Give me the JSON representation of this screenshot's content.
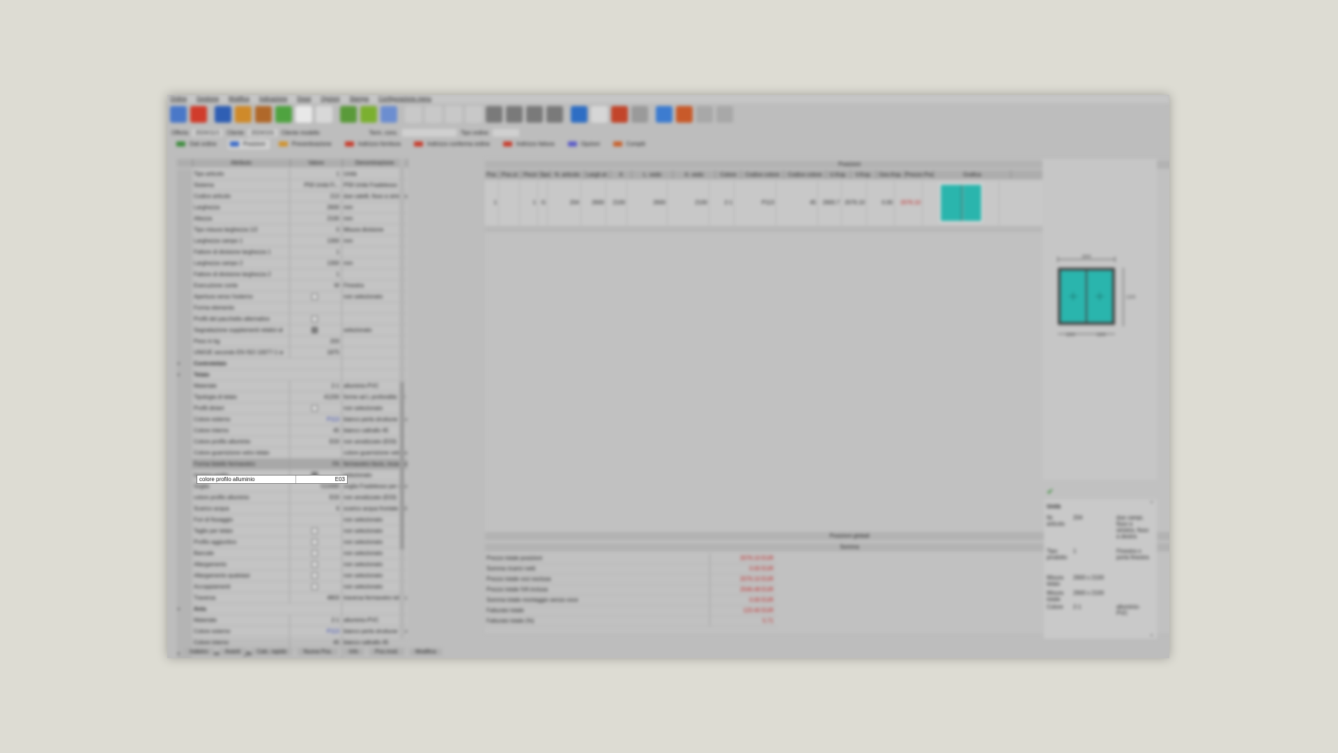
{
  "menu": [
    "Ordine",
    "Gestione",
    "Modifica",
    "Indicazione",
    "Dossi",
    "Opzioni",
    "Stampa",
    "Configurazione menu"
  ],
  "toolbar": {
    "icons": [
      {
        "name": "settings-icon",
        "color": "#4a78c8"
      },
      {
        "name": "stop-icon",
        "color": "#d03c2c"
      },
      {
        "name": "save-icon",
        "color": "#2f5fb4"
      },
      {
        "name": "users-icon",
        "color": "#cf8a2a"
      },
      {
        "name": "group-icon",
        "color": "#b0682a"
      },
      {
        "name": "recycle-icon",
        "color": "#4fa340"
      },
      {
        "name": "document-icon",
        "color": "#e8e8e8"
      },
      {
        "name": "list-icon",
        "color": "#d8d8d8"
      },
      {
        "name": "tree-icon",
        "color": "#5a9a3a"
      },
      {
        "name": "edit-icon",
        "color": "#7bb030"
      },
      {
        "name": "table-icon",
        "color": "#6c8ed0"
      },
      {
        "name": "cut-icon",
        "color": "#c8c8c8"
      },
      {
        "name": "arrow-left-icon",
        "color": "#c8c8c8"
      },
      {
        "name": "arrow-right-icon",
        "color": "#c8c8c8"
      },
      {
        "name": "print-icon",
        "color": "#c8c8c8"
      },
      {
        "name": "window-icon",
        "color": "#7a7a7a"
      },
      {
        "name": "window2-icon",
        "color": "#7a7a7a"
      },
      {
        "name": "window3-icon",
        "color": "#7a7a7a"
      },
      {
        "name": "window4-icon",
        "color": "#7a7a7a"
      },
      {
        "name": "globe-icon",
        "color": "#2e6ec4"
      },
      {
        "name": "paper-icon",
        "color": "#d6d6d6"
      },
      {
        "name": "shapes-icon",
        "color": "#c2452a"
      },
      {
        "name": "info-icon",
        "color": "#9a9a9a"
      },
      {
        "name": "refresh-icon",
        "color": "#3d7cd0"
      },
      {
        "name": "flowers-icon",
        "color": "#c85a2a"
      },
      {
        "name": "filter-icon",
        "color": "#a8a8a8"
      },
      {
        "name": "trash-icon",
        "color": "#a8a8a8"
      }
    ]
  },
  "filters": {
    "offer_label": "Offerta",
    "offer_value": "2024/11/1",
    "client_label": "Cliente",
    "client_code": "2024/101",
    "client_name": "Cliente modello",
    "date_label": "Term. cons.",
    "date_value": "",
    "type_label": "Tipo ordine",
    "type_value": ""
  },
  "tabs": [
    "Dati ordine",
    "Posizioni",
    "Preventivazione",
    "Indirizzo fornitura",
    "Indirizzo conferma ordine",
    "Indirizzo fattura",
    "Opzioni",
    "Compiti"
  ],
  "left": {
    "headers": [
      "Attributo",
      "Valore",
      "Denominazione"
    ],
    "rows": [
      {
        "attr": "Tipo articolo",
        "val": "1",
        "desc": "Unità"
      },
      {
        "attr": "Sistema",
        "val": "P59 Unità Fi...",
        "desc": "P59 Unità Fradelesso"
      },
      {
        "attr": "Codice articolo",
        "val": "213",
        "desc": "due catelli, fisso a sinistra, fisso a destra"
      },
      {
        "attr": "Larghezza",
        "val": "2600",
        "desc": "mm"
      },
      {
        "attr": "Altezza",
        "val": "2100",
        "desc": "mm"
      },
      {
        "attr": "Tipo misura larghezza 1/2",
        "val": "0",
        "desc": "Misura divisione"
      },
      {
        "attr": "Larghezza campo 1",
        "val": "1300",
        "desc": "mm"
      },
      {
        "attr": "Fattore di divisione larghezza 1",
        "val": "1",
        "desc": ""
      },
      {
        "attr": "Larghezza campo 2",
        "val": "1300",
        "desc": "mm"
      },
      {
        "attr": "Fattore di divisione larghezza 2",
        "val": "1",
        "desc": ""
      },
      {
        "attr": "Esecuzione conte",
        "val": "W",
        "desc": "Finestra"
      },
      {
        "attr": "Apertura verso l'esterno",
        "val": "[ ]",
        "desc": "non selezionato"
      },
      {
        "attr": "Forma elemento",
        "val": "",
        "desc": ""
      },
      {
        "attr": "Profili del pacchetto alternativo",
        "val": "[ ]",
        "desc": ""
      },
      {
        "attr": "Segnalazione supplementi relativi al",
        "val": "[x]",
        "desc": "selezionato"
      },
      {
        "attr": "Peso in kg",
        "val": "203",
        "desc": ""
      },
      {
        "attr": "UNI/UE secondo EN ISO 10077-1 w",
        "val": "1875",
        "desc": ""
      },
      {
        "attr": "Controtelaio",
        "val": "",
        "desc": "",
        "section": true
      },
      {
        "attr": "Telaio",
        "val": "",
        "desc": "",
        "section": true
      },
      {
        "attr": "Materiale",
        "val": "2-1",
        "desc": "alluminio-PVC"
      },
      {
        "attr": "Tipologia di telaio",
        "val": "41200",
        "desc": "forme ad L profondità: 73 mm, tegolato s"
      },
      {
        "attr": "Profili dinieri",
        "val": "[ ]",
        "desc": "non selezionato"
      },
      {
        "attr": "Colore esterno",
        "val": "P113",
        "desc": "bianco perla strutturar fine P113 (Ral. 1013)",
        "blue": true
      },
      {
        "attr": "Colore interno",
        "val": "45",
        "desc": "bianco caltrallo 45"
      },
      {
        "attr": "Colore profilo alluminio",
        "val": "E03",
        "desc": "non anodizzato (E03)"
      },
      {
        "attr": "Colore guarnizione vetro telaio",
        "val": "",
        "desc": "colore guarnizione vetro standard"
      },
      {
        "attr": "Forma listello fermavetro",
        "val": "FA",
        "desc": "fermavetro liscio, incassato",
        "selected": true
      },
      {
        "attr": "Incerno soglia",
        "val": "[x]",
        "desc": "selezionato"
      },
      {
        "attr": "Soglia",
        "val": "510490",
        "desc": "soglia Fradelesso per elemento fisso"
      },
      {
        "attr": "colore profilo alluminio",
        "val": "E03",
        "desc": "non anodizzato (E03)"
      },
      {
        "attr": "Scarico acqua",
        "val": "6",
        "desc": "scarico acqua frontale sul telaio"
      },
      {
        "attr": "Fori di fissaggio",
        "val": "",
        "desc": "non selezionato"
      },
      {
        "attr": "Taglio per telaio",
        "val": "[ ]",
        "desc": "non selezionato"
      },
      {
        "attr": "Profilo aggiuntivo",
        "val": "[ ]",
        "desc": "non selezionato"
      },
      {
        "attr": "Bancale",
        "val": "[ ]",
        "desc": "non selezionato"
      },
      {
        "attr": "Allargamento",
        "val": "[ ]",
        "desc": "non selezionato"
      },
      {
        "attr": "Allargamento qualsiasi",
        "val": "[ ]",
        "desc": "non selezionato"
      },
      {
        "attr": "Accoppiamenti",
        "val": "[ ]",
        "desc": "non selezionato"
      },
      {
        "attr": "Traversa",
        "val": "4803",
        "desc": "traversa fermavetro telaio, profondità: 107"
      },
      {
        "attr": "Anta",
        "val": "",
        "desc": "",
        "section": true
      },
      {
        "attr": "Materiale",
        "val": "2-1",
        "desc": "alluminio-PVC"
      },
      {
        "attr": "Colore esterno",
        "val": "P113",
        "desc": "bianco perla strutturar fine P113 (Ral. 1013)",
        "blue": true
      },
      {
        "attr": "Colore interno",
        "val": "45",
        "desc": "bianco caltrallo 45"
      },
      {
        "attr": "Ferramenta e maniglia",
        "val": "",
        "desc": "",
        "section": true
      },
      {
        "attr": "Vetro",
        "val": "",
        "desc": ""
      }
    ],
    "active": {
      "attr": "colore profilo alluminio",
      "val": "E03"
    }
  },
  "center": {
    "title": "Posizioni",
    "headers": [
      "Pos.",
      "Pos.ul.",
      "Pezzi",
      "Spo.",
      "N. articolo",
      "Largh.el.",
      "A",
      "L. vedo",
      "A. vedo",
      "Colore",
      "Codice colore",
      "Codice colore",
      "U.Kop.",
      "V.Kop.",
      "Ges.Kop.",
      "Prezzo Pos.",
      "Grafica"
    ],
    "row": [
      "1",
      "",
      "1",
      "G",
      "204",
      "2600",
      "2100",
      "2600",
      "2100",
      "2-1",
      "P113",
      "45",
      "2600.7",
      "2076.10",
      "0.00",
      "2076.10",
      ""
    ],
    "row_marker": "T",
    "global_bar": "Posizioni globali",
    "sum_bar": "Somma",
    "totals": [
      {
        "label": "Prezzo totale posizioni",
        "value": "2076.10 EUR"
      },
      {
        "label": "Somma ricarici netti",
        "value": "0.00 EUR"
      },
      {
        "label": "Prezzo totale voci esclusa",
        "value": "2076.10 EUR"
      },
      {
        "label": "Prezzo totale IVA inclusa",
        "value": "2546.48 EUR"
      },
      {
        "label": "Somma totale montaggio senza voce",
        "value": "0.00 EUR"
      },
      {
        "label": "Fatturato totale",
        "value": "123.40 EUR"
      },
      {
        "label": "Fatturato totale (%)",
        "value": "5.71"
      }
    ]
  },
  "drawing": {
    "width_label": "2600",
    "height_label": "2100",
    "left_label": "1300",
    "right_label": "1300",
    "glass_color": "#2ab5ad"
  },
  "info": {
    "title": "Unità",
    "rows": [
      {
        "k": "Nr. articolo",
        "n": "204",
        "d": "due campi, fisso a sinistra, fisso a destra"
      },
      {
        "k": "Tipo prodotto",
        "n": "1",
        "d": "Finestra o porta finestra"
      },
      {
        "k": "Misura telaio",
        "n": "2600 x 2100",
        "d": ""
      },
      {
        "k": "Misura totale",
        "n": "2600 x 2100",
        "d": ""
      },
      {
        "k": "Colore",
        "n": "2-1",
        "d": "alluminio-PVC"
      }
    ]
  },
  "status": [
    "Indietro",
    "Avanti",
    "Calc. rapido",
    "Nuova Pos.",
    "Info",
    "Pos.mod.",
    "Modifica"
  ]
}
